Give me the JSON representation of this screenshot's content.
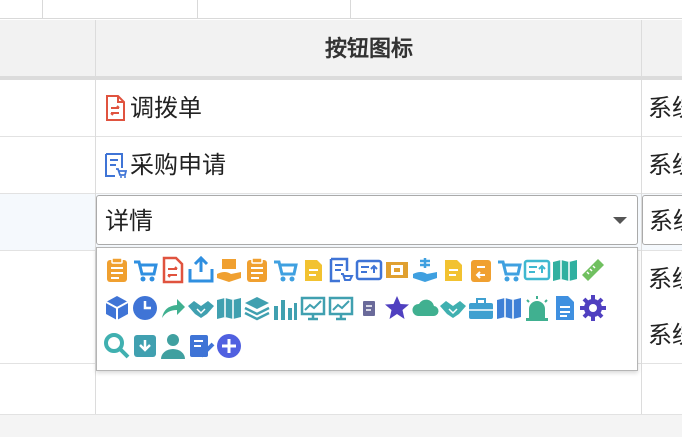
{
  "header": {
    "column_title": "按钮图标"
  },
  "rows": [
    {
      "label": "调拨单",
      "icon": "transfer-doc-icon",
      "icon_color": "#e0533f",
      "system": "系统"
    },
    {
      "label": "采购申请",
      "icon": "purchase-request-icon",
      "icon_color": "#3f74d6",
      "system": "系统"
    },
    {
      "label": "",
      "system": "系统"
    },
    {
      "label": "",
      "system": "系统"
    }
  ],
  "editor": {
    "selected_value": "详情",
    "system_value": "系统"
  },
  "icon_picker": {
    "rows": [
      [
        {
          "name": "clipboard-list-icon",
          "color": "#f0a030"
        },
        {
          "name": "shopping-cart-icon",
          "color": "#2f8fe0"
        },
        {
          "name": "transfer-doc-icon",
          "color": "#e0533f"
        },
        {
          "name": "upload-tray-icon",
          "color": "#2f8fe0"
        },
        {
          "name": "hand-upload-icon",
          "color": "#f0a030"
        },
        {
          "name": "clipboard-return-icon",
          "color": "#f0a030"
        },
        {
          "name": "cart-card-icon",
          "color": "#3fa0e0"
        },
        {
          "name": "doc-yellow-icon",
          "color": "#f2c230"
        },
        {
          "name": "purchase-request-icon",
          "color": "#3f74d6"
        },
        {
          "name": "card-up-icon",
          "color": "#3f74d6"
        },
        {
          "name": "film-card-icon",
          "color": "#e0a030"
        },
        {
          "name": "hand-money-icon",
          "color": "#3fa0e0"
        },
        {
          "name": "doc-edit-yellow-icon",
          "color": "#f2c230"
        },
        {
          "name": "return-yellow-icon",
          "color": "#f0a030"
        },
        {
          "name": "cart-small-icon",
          "color": "#3fa0e0"
        },
        {
          "name": "card-teal-icon",
          "color": "#3fb8d0"
        },
        {
          "name": "book-teal-icon",
          "color": "#30b0a0"
        },
        {
          "name": "ruler-pencil-icon",
          "color": "#70c060"
        }
      ],
      [
        {
          "name": "cube-icon",
          "color": "#3f74d6"
        },
        {
          "name": "clock-icon",
          "color": "#3f74d6"
        },
        {
          "name": "share-arrow-icon",
          "color": "#40b090"
        },
        {
          "name": "handshake-icon",
          "color": "#40a0b0"
        },
        {
          "name": "map-icon",
          "color": "#40a0b0"
        },
        {
          "name": "layers-icon",
          "color": "#40a0b0"
        },
        {
          "name": "bar-chart-icon",
          "color": "#40a0b0"
        },
        {
          "name": "presentation-line-icon",
          "color": "#40a0b0"
        },
        {
          "name": "monitor-chart-icon",
          "color": "#40a0b0"
        },
        {
          "name": "small-doc-icon",
          "color": "#6a6a9a"
        },
        {
          "name": "star-icon",
          "color": "#5040c0"
        },
        {
          "name": "cloud-icon",
          "color": "#40b090"
        },
        {
          "name": "handshake-teal-icon",
          "color": "#40b0b0"
        },
        {
          "name": "briefcase-icon",
          "color": "#3fa0d0"
        },
        {
          "name": "open-book-icon",
          "color": "#3f80d6"
        },
        {
          "name": "alarm-icon",
          "color": "#40b090"
        },
        {
          "name": "file-blue-icon",
          "color": "#3f90e0"
        },
        {
          "name": "gear-icon",
          "color": "#5040c0"
        }
      ],
      [
        {
          "name": "search-icon",
          "color": "#40b0b0"
        },
        {
          "name": "archive-download-icon",
          "color": "#40a0b0"
        },
        {
          "name": "user-icon",
          "color": "#40a0a0"
        },
        {
          "name": "note-edit-icon",
          "color": "#3f74d6"
        },
        {
          "name": "add-circle-icon",
          "color": "#5060e0"
        }
      ]
    ]
  }
}
